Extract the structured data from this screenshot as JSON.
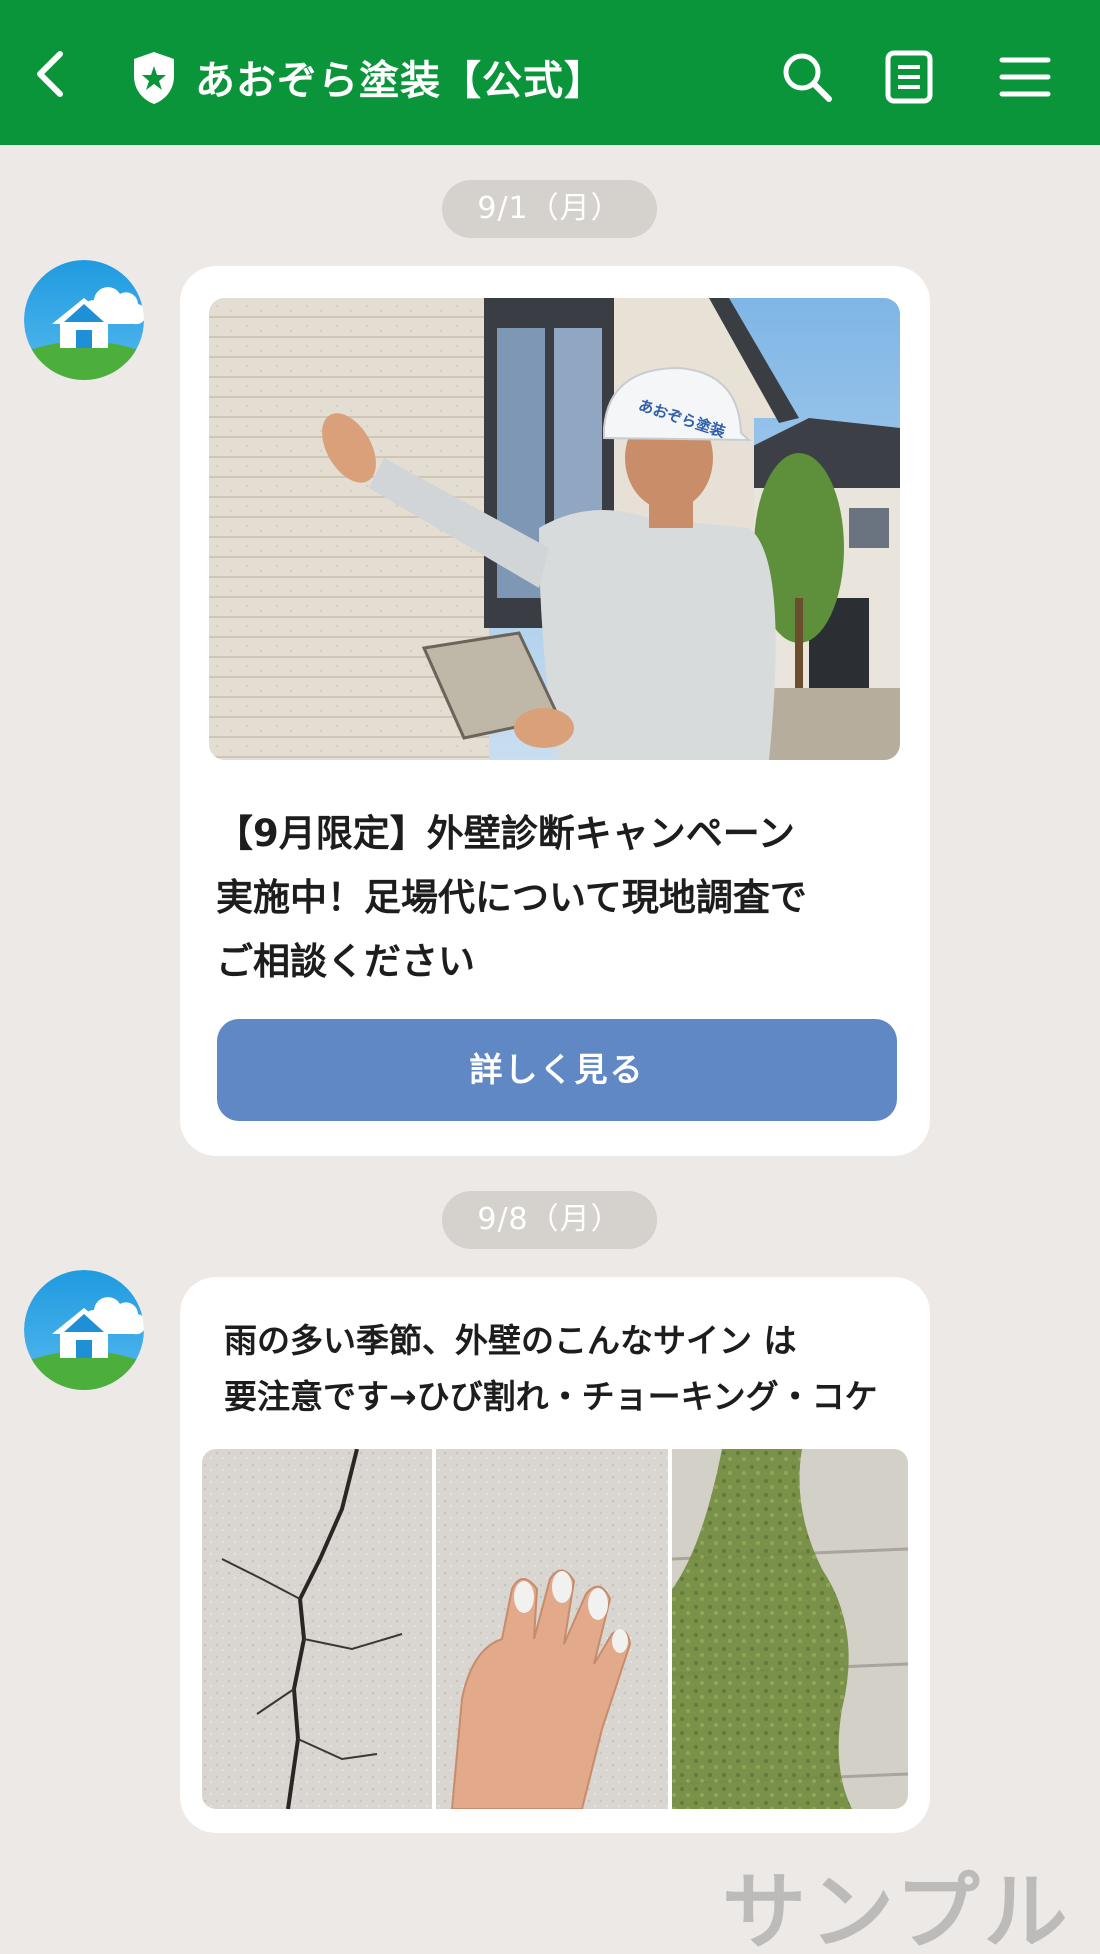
{
  "header": {
    "title": "あおぞら塗装【公式】",
    "bg_color": "#0a953a",
    "icons": [
      "back-chevron-icon",
      "verified-shield-icon",
      "search-icon",
      "notes-icon",
      "menu-icon"
    ]
  },
  "messages": [
    {
      "date": "9/1（月）",
      "image_alt": "外壁を点検する作業員",
      "helmet_text": "あおぞら塗装",
      "text_lines": [
        "【9月限定】外壁診断キャンペーン",
        "実施中！足場代について現地調査で",
        "ご相談ください"
      ],
      "button_label": "詳しく見る",
      "button_color": "#6088c5"
    },
    {
      "date": "9/8（月）",
      "text_lines": [
        "雨の多い季節、外壁のこんなサイン は",
        "要注意です→ひび割れ・チョーキング・コケ"
      ],
      "thumbnails": [
        "ひび割れ",
        "チョーキング",
        "コケ"
      ]
    }
  ],
  "watermark": "サンプル"
}
